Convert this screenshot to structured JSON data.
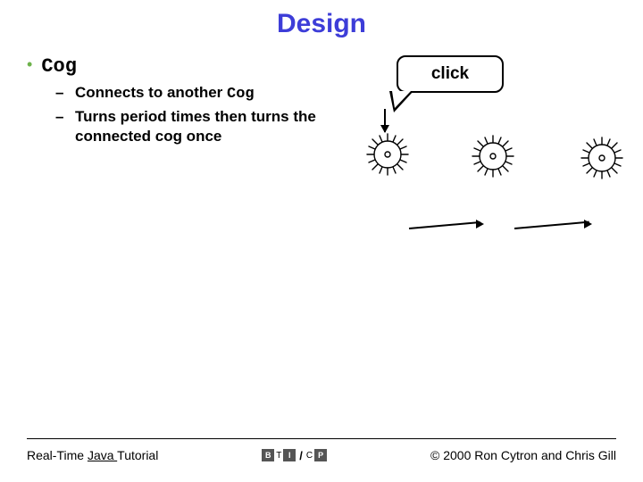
{
  "title": "Design",
  "bullet": {
    "main": "Cog",
    "items": [
      {
        "prefix": "Connects to another ",
        "mono": "Cog",
        "suffix": ""
      },
      {
        "prefix": "Turns period times then turns the connected cog once",
        "mono": "",
        "suffix": ""
      }
    ]
  },
  "callout": "click",
  "footer": {
    "left_prefix": "Real-Time ",
    "left_link": "Java ",
    "left_suffix": "Tutorial",
    "center_letters": [
      "B",
      "T",
      "I",
      "C",
      "P"
    ],
    "right": "© 2000 Ron Cytron and Chris Gill"
  }
}
